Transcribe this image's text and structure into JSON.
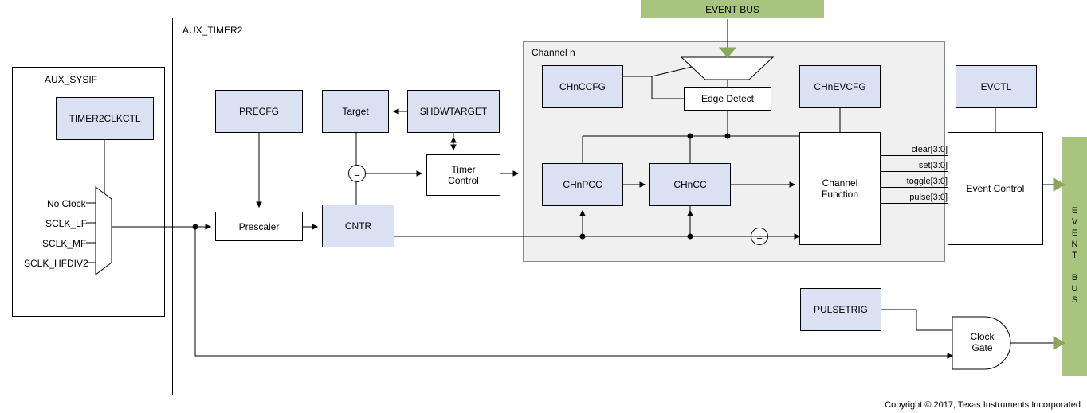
{
  "event_bus_top": "EVENT BUS",
  "event_bus_right": "EVENT BUS",
  "aux_sysif": {
    "title": "AUX_SYSIF",
    "reg": "TIMER2CLKCTL",
    "clocks": [
      "No Clock",
      "SCLK_LF",
      "SCLK_MF",
      "SCLK_HFDIV2"
    ]
  },
  "aux_timer2": {
    "title": "AUX_TIMER2",
    "precfg": "PRECFG",
    "prescaler": "Prescaler",
    "target": "Target",
    "shdwtarget": "SHDWTARGET",
    "eq": "=",
    "timer_control": "Timer\nControl",
    "cntr": "CNTR",
    "pulsetrig": "PULSETRIG",
    "clock_gate": "Clock\nGate"
  },
  "channel": {
    "title": "Channel n",
    "chnccfg": "CHnCCFG",
    "edge_detect": "Edge Detect",
    "chnevcfg": "CHnEVCFG",
    "chnpcc": "CHnPCC",
    "chncc": "CHnCC",
    "eq": "=",
    "channel_function": "Channel\nFunction"
  },
  "evctl": {
    "reg": "EVCTL",
    "event_control": "Event Control",
    "signals": [
      "clear[3:0]",
      "set[3:0]",
      "toggle[3:0]",
      "pulse[3:0]"
    ]
  },
  "copyright": "Copyright © 2017, Texas Instruments Incorporated"
}
